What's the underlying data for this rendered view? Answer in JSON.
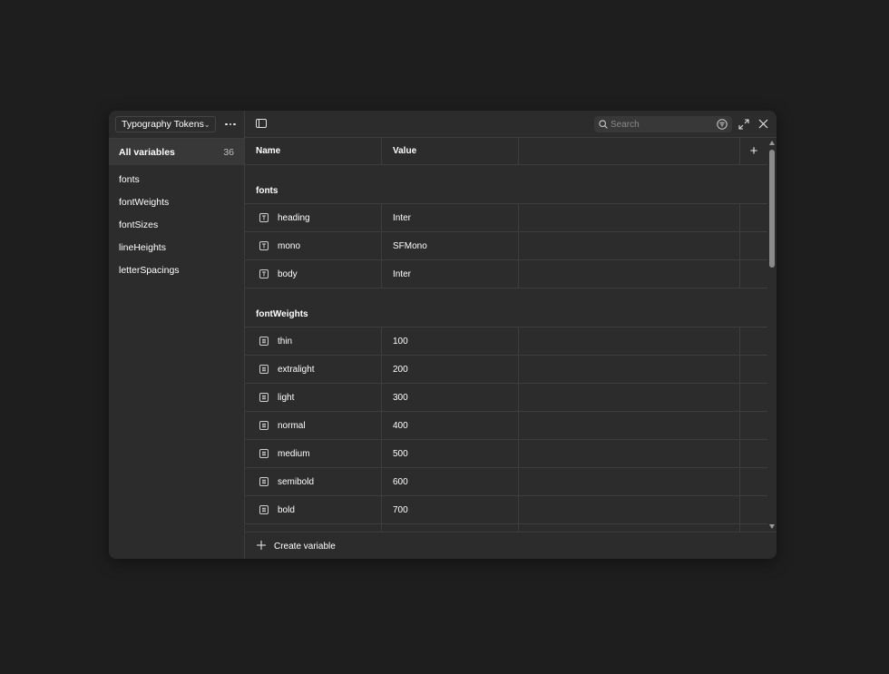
{
  "sidebar": {
    "collection": "Typography Tokens",
    "all_variables_label": "All variables",
    "all_variables_count": "36",
    "groups": [
      {
        "label": "fonts"
      },
      {
        "label": "fontWeights"
      },
      {
        "label": "fontSizes"
      },
      {
        "label": "lineHeights"
      },
      {
        "label": "letterSpacings"
      }
    ]
  },
  "toolbar": {
    "search_placeholder": "Search"
  },
  "table": {
    "columns": {
      "name": "Name",
      "value": "Value"
    },
    "groups": [
      {
        "label": "fonts",
        "type": "string",
        "rows": [
          {
            "name": "heading",
            "value": "Inter"
          },
          {
            "name": "mono",
            "value": "SFMono"
          },
          {
            "name": "body",
            "value": "Inter"
          }
        ]
      },
      {
        "label": "fontWeights",
        "type": "number",
        "rows": [
          {
            "name": "thin",
            "value": "100"
          },
          {
            "name": "extralight",
            "value": "200"
          },
          {
            "name": "light",
            "value": "300"
          },
          {
            "name": "normal",
            "value": "400"
          },
          {
            "name": "medium",
            "value": "500"
          },
          {
            "name": "semibold",
            "value": "600"
          },
          {
            "name": "bold",
            "value": "700"
          }
        ]
      }
    ]
  },
  "footer": {
    "create_label": "Create variable"
  },
  "colors": {
    "background": "#1e1e1e",
    "panel": "#2c2c2c",
    "border": "#3d3d3d",
    "selected": "#383838"
  },
  "icons": {
    "string_type": "text-type-icon",
    "number_type": "number-type-icon"
  }
}
